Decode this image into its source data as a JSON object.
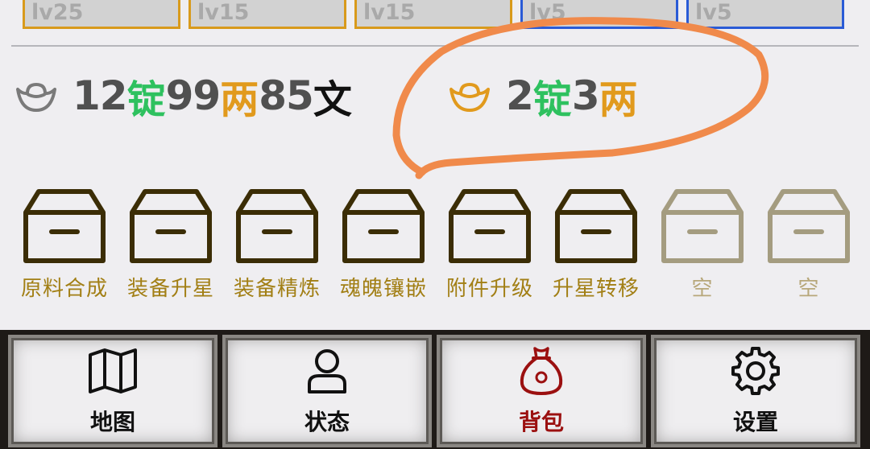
{
  "slots": [
    {
      "level": "lv25",
      "border": "gold"
    },
    {
      "level": "lv15",
      "border": "gold"
    },
    {
      "level": "lv15",
      "border": "gold"
    },
    {
      "level": "lv5",
      "border": "blue"
    },
    {
      "level": "lv5",
      "border": "blue"
    }
  ],
  "silver": {
    "ding_amount": "12",
    "ding_unit": "锭",
    "liang_amount": "99",
    "liang_unit": "两",
    "wen_amount": "85",
    "wen_unit": "文",
    "icon": "silver-ingot-icon"
  },
  "gold": {
    "ding_amount": "2",
    "ding_unit": "锭",
    "liang_amount": "3",
    "liang_unit": "两",
    "icon": "gold-ingot-icon"
  },
  "functions": [
    {
      "label": "原料合成",
      "enabled": true
    },
    {
      "label": "装备升星",
      "enabled": true
    },
    {
      "label": "装备精炼",
      "enabled": true
    },
    {
      "label": "魂魄镶嵌",
      "enabled": true
    },
    {
      "label": "附件升级",
      "enabled": true
    },
    {
      "label": "升星转移",
      "enabled": true
    },
    {
      "label": "空",
      "enabled": false
    },
    {
      "label": "空",
      "enabled": false
    }
  ],
  "nav": [
    {
      "label": "地图",
      "icon": "map-icon",
      "active": false
    },
    {
      "label": "状态",
      "icon": "user-icon",
      "active": false
    },
    {
      "label": "背包",
      "icon": "money-bag-icon",
      "active": true
    },
    {
      "label": "设置",
      "icon": "gear-icon",
      "active": false
    }
  ],
  "colors": {
    "ding": "#2ec15f",
    "liang": "#e19a1d",
    "wen": "#111111",
    "number": "#505050",
    "annotation": "#f08a4b",
    "active_tab": "#9b1010"
  }
}
